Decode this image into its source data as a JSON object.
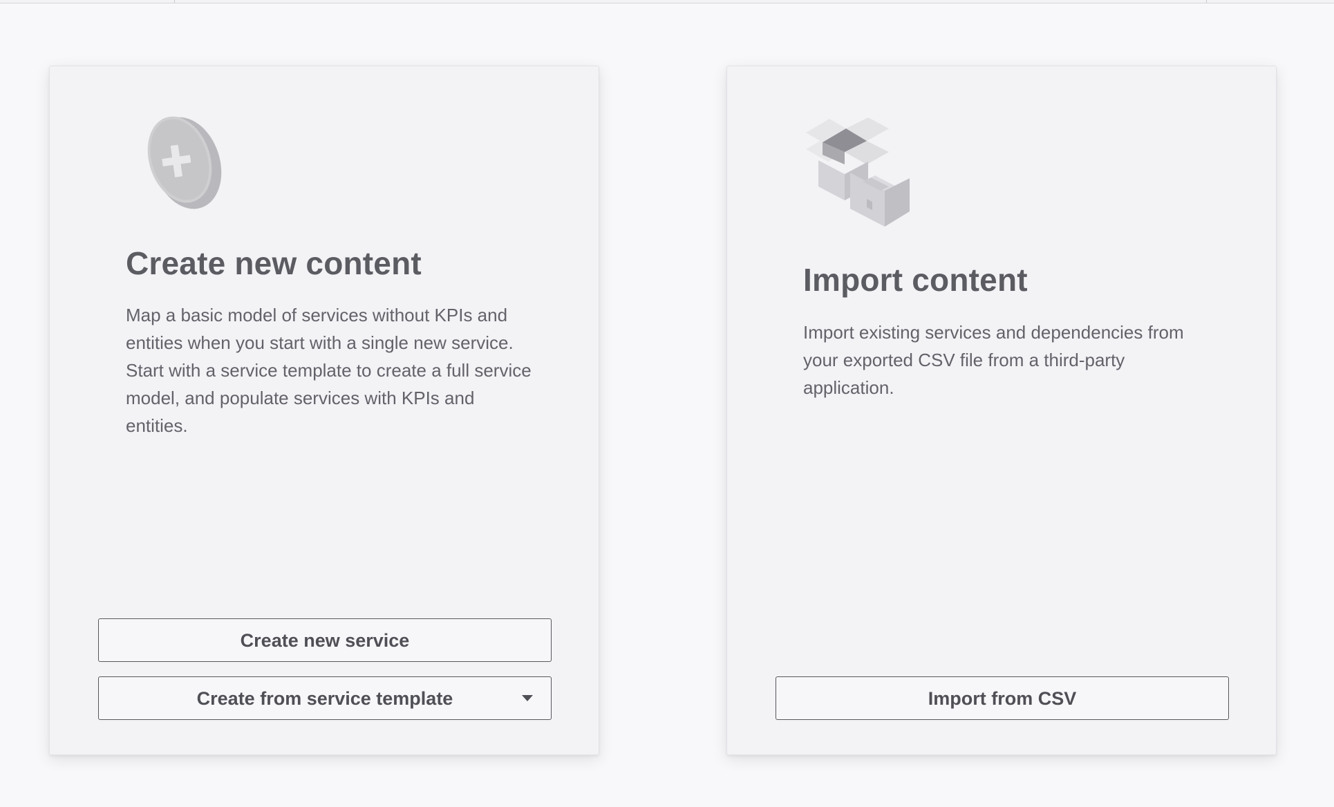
{
  "create_card": {
    "icon": "add-coin-icon",
    "title": "Create new content",
    "description": "Map a basic model of services without KPIs and entities when you start with a single new service. Start with a service template to create a full service model, and populate services with KPIs and entities.",
    "primary_button": "Create new service",
    "template_button": "Create from service template",
    "template_button_icon": "caret-down-icon"
  },
  "import_card": {
    "icon": "boxes-icon",
    "title": "Import content",
    "description": "Import existing services and dependencies from your exported CSV file from a third-party application.",
    "primary_button": "Import from CSV"
  },
  "colors": {
    "background": "#f8f8fa",
    "card": "#f3f3f6",
    "text": "#5c5c63",
    "button_border": "#56565c"
  }
}
